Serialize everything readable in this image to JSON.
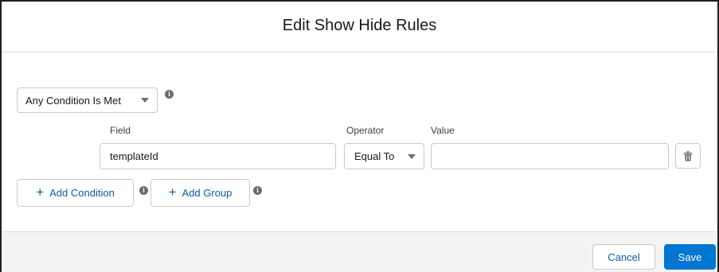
{
  "modal": {
    "title": "Edit Show Hide Rules"
  },
  "rules": {
    "logic_select": {
      "value": "Any Condition Is Met"
    },
    "condition": {
      "field_label": "Field",
      "field_value": "templateId",
      "operator_label": "Operator",
      "operator_value": "Equal To",
      "value_label": "Value",
      "value_value": ""
    },
    "add_condition_label": "Add Condition",
    "add_group_label": "Add Group"
  },
  "footer": {
    "cancel_label": "Cancel",
    "save_label": "Save"
  },
  "icons": {
    "info": "info-icon",
    "delete": "trash-icon",
    "add": "plus-icon",
    "dropdown": "chevron-down-icon"
  },
  "colors": {
    "brand_blue": "#0176d3",
    "link_blue": "#0b5cab",
    "border": "#c9c9c9",
    "footer_bg": "#f3f3f3"
  }
}
